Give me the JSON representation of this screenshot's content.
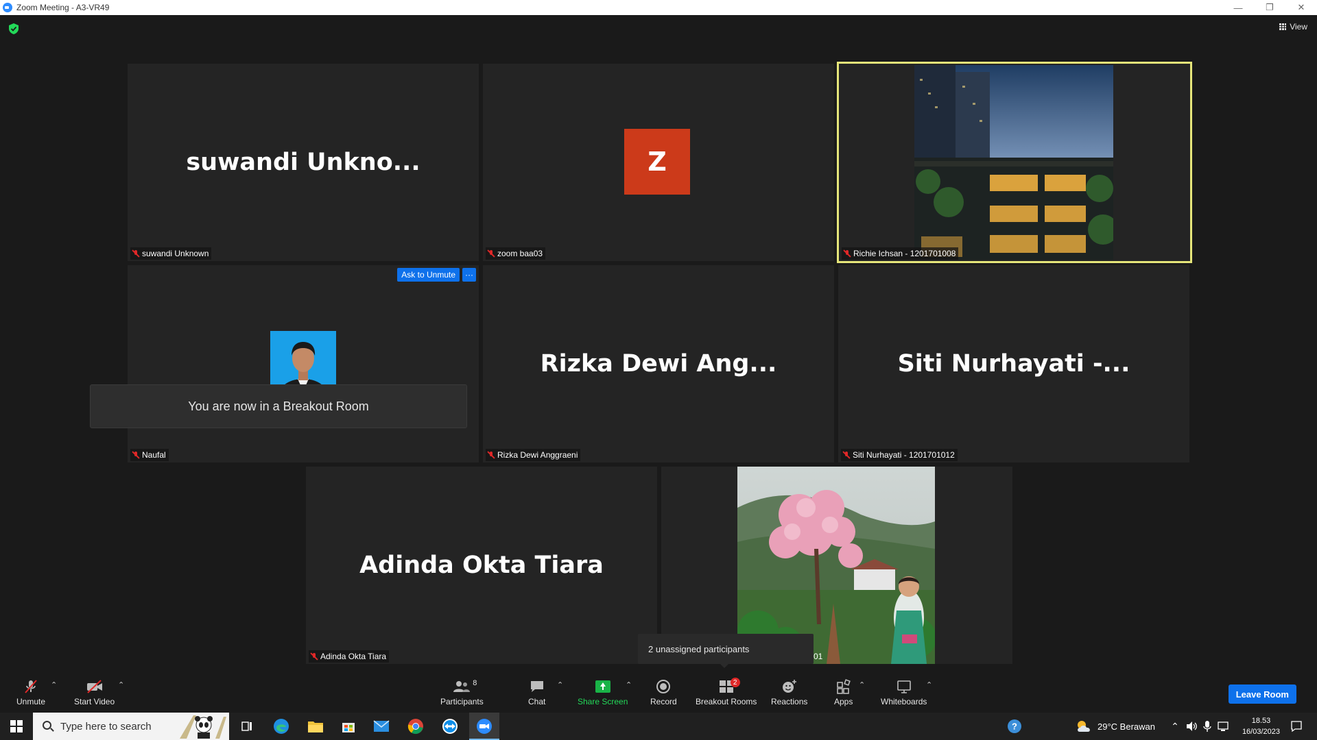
{
  "window": {
    "title": "Zoom Meeting - A3-VR49"
  },
  "header": {
    "view_label": "View"
  },
  "tiles": [
    {
      "big_name": "suwandi  Unkno...",
      "label": "suwandi Unknown"
    },
    {
      "avatar_letter": "Z",
      "label": "zoom baa03"
    },
    {
      "label": "Richie Ichsan - 1201701008"
    },
    {
      "label": "Naufal"
    },
    {
      "big_name": "Rizka Dewi Ang...",
      "label": "Rizka Dewi Anggraeni"
    },
    {
      "big_name": "Siti  Nurhayati -...",
      "label": "Siti Nurhayati - 1201701012"
    },
    {
      "big_name": "Adinda Okta Tiara",
      "label": "Adinda Okta Tiara"
    },
    {
      "label_fragment": "01"
    }
  ],
  "tile_actions": {
    "ask_to_unmute": "Ask to Unmute",
    "more": "···"
  },
  "notification": {
    "breakout_toast": "You are now in a Breakout Room",
    "unassigned_tooltip": "2 unassigned participants"
  },
  "toolbar": {
    "unmute": "Unmute",
    "start_video": "Start Video",
    "participants": "Participants",
    "participants_count": "8",
    "chat": "Chat",
    "share_screen": "Share Screen",
    "record": "Record",
    "breakout_rooms": "Breakout Rooms",
    "breakout_badge": "2",
    "reactions": "Reactions",
    "apps": "Apps",
    "whiteboards": "Whiteboards",
    "leave_room": "Leave Room"
  },
  "taskbar": {
    "search_placeholder": "Type here to search",
    "weather": "29°C  Berawan",
    "time": "18.53",
    "date": "16/03/2023"
  },
  "colors": {
    "accent_blue": "#0e71eb",
    "active_speaker": "#e6e67a",
    "share_green": "#19b347",
    "avatar_orange": "#cc3a1a",
    "muted_red": "#e02828"
  }
}
